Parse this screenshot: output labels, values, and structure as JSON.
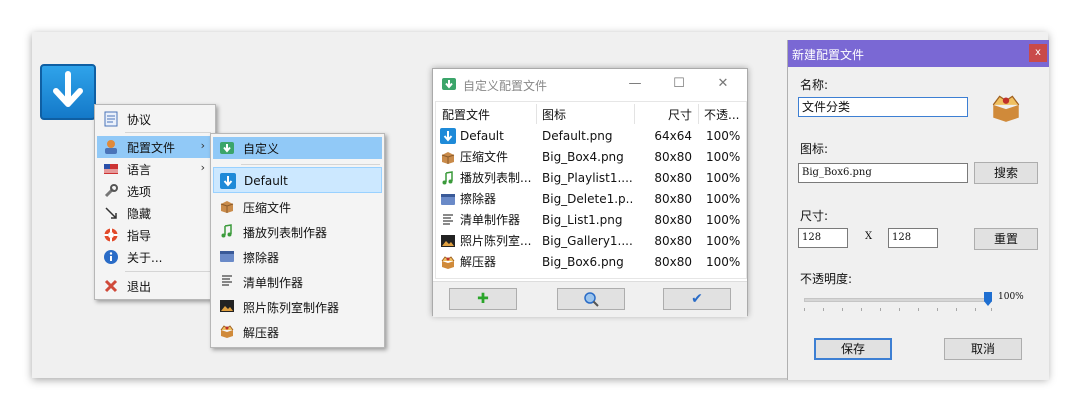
{
  "context_menu": {
    "items": [
      {
        "label": "协议",
        "icon": "protocol-icon",
        "has_submenu": false
      },
      {
        "label": "配置文件",
        "icon": "profile-icon",
        "has_submenu": true
      },
      {
        "label": "语言",
        "icon": "flag-icon",
        "has_submenu": true
      },
      {
        "label": "选项",
        "icon": "wrench-icon",
        "has_submenu": false
      },
      {
        "label": "隐藏",
        "icon": "hide-icon",
        "has_submenu": false
      },
      {
        "label": "指导",
        "icon": "lifebuoy-icon",
        "has_submenu": false
      },
      {
        "label": "关于...",
        "icon": "info-icon",
        "has_submenu": false
      },
      {
        "label": "退出",
        "icon": "exit-icon",
        "has_submenu": false
      }
    ],
    "arrow": "›"
  },
  "submenu": {
    "items": [
      {
        "label": "自定义",
        "icon": "custom-icon"
      },
      {
        "label": "Default",
        "icon": "download-arrow-icon"
      },
      {
        "label": "压缩文件",
        "icon": "box-icon"
      },
      {
        "label": "播放列表制作器",
        "icon": "music-note-icon"
      },
      {
        "label": "擦除器",
        "icon": "eraser-icon"
      },
      {
        "label": "清单制作器",
        "icon": "list-icon"
      },
      {
        "label": "照片陈列室制作器",
        "icon": "gallery-icon"
      },
      {
        "label": "解压器",
        "icon": "open-box-icon"
      }
    ]
  },
  "profile_window": {
    "title": "自定义配置文件",
    "controls": {
      "minimize": "—",
      "maximize": "☐",
      "close": "✕"
    },
    "columns": [
      "配置文件",
      "图标",
      "尺寸",
      "不透..."
    ],
    "rows": [
      {
        "name": "Default",
        "icon_file": "Default.png",
        "size": "64x64",
        "opacity": "100%",
        "icon": "download-arrow-icon"
      },
      {
        "name": "压缩文件",
        "icon_file": "Big_Box4.png",
        "size": "80x80",
        "opacity": "100%",
        "icon": "box-icon"
      },
      {
        "name": "播放列表制...",
        "icon_file": "Big_Playlist1....",
        "size": "80x80",
        "opacity": "100%",
        "icon": "music-note-icon"
      },
      {
        "name": "擦除器",
        "icon_file": "Big_Delete1.p...",
        "size": "80x80",
        "opacity": "100%",
        "icon": "eraser-icon"
      },
      {
        "name": "清单制作器",
        "icon_file": "Big_List1.png",
        "size": "80x80",
        "opacity": "100%",
        "icon": "list-icon"
      },
      {
        "name": "照片陈列室...",
        "icon_file": "Big_Gallery1....",
        "size": "80x80",
        "opacity": "100%",
        "icon": "gallery-icon"
      },
      {
        "name": "解压器",
        "icon_file": "Big_Box6.png",
        "size": "80x80",
        "opacity": "100%",
        "icon": "open-box-icon"
      }
    ],
    "buttons": {
      "add": "✚",
      "search": "search-icon",
      "confirm": "✔"
    }
  },
  "new_profile_dialog": {
    "title": "新建配置文件",
    "close": "x",
    "name_label": "名称:",
    "name_value": "文件分类",
    "icon_label": "图标:",
    "icon_value": "Big_Box6.png",
    "search_button": "搜索",
    "size_label": "尺寸:",
    "width_value": "128",
    "size_separator": "X",
    "height_value": "128",
    "reset_button": "重置",
    "opacity_label": "不透明度:",
    "opacity_value": "100%",
    "opacity_fraction": 1.0,
    "save_button": "保存",
    "cancel_button": "取消"
  },
  "colors": {
    "menu_highlight": "#91c9f7",
    "menu_selected": "#cce8ff",
    "dialog_title_bar": "#7a68d4",
    "dialog_close": "#c94a4a",
    "accent_blue": "#1f6fd1"
  }
}
